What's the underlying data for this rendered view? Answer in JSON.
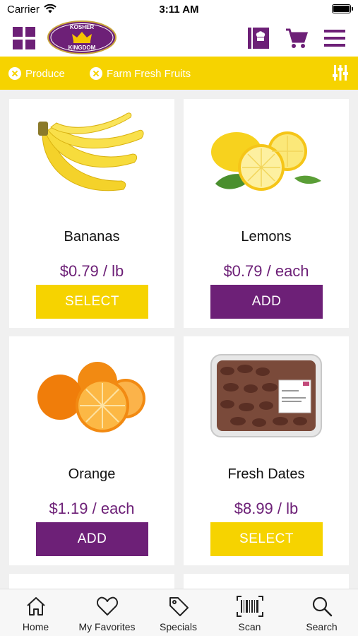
{
  "status_bar": {
    "carrier": "Carrier",
    "time": "3:11 AM"
  },
  "header": {
    "logo_text": {
      "top": "KOSHER",
      "bottom": "KINGDOM"
    },
    "icons": [
      "grid-icon",
      "recipe-book-icon",
      "cart-icon",
      "menu-icon"
    ]
  },
  "filters": [
    {
      "label": "Produce"
    },
    {
      "label": "Farm Fresh Fruits"
    }
  ],
  "products": [
    {
      "name": "Bananas",
      "price": "$0.79 / lb",
      "button": "SELECT",
      "button_style": "yellow"
    },
    {
      "name": "Lemons",
      "price": "$0.79 / each",
      "button": "ADD",
      "button_style": "purple"
    },
    {
      "name": "Orange",
      "price": "$1.19 / each",
      "button": "ADD",
      "button_style": "purple"
    },
    {
      "name": "Fresh Dates",
      "price": "$8.99 / lb",
      "button": "SELECT",
      "button_style": "yellow"
    }
  ],
  "tabbar": [
    {
      "label": "Home",
      "icon": "home-icon"
    },
    {
      "label": "My Favorites",
      "icon": "heart-icon"
    },
    {
      "label": "Specials",
      "icon": "tag-icon"
    },
    {
      "label": "Scan",
      "icon": "barcode-icon"
    },
    {
      "label": "Search",
      "icon": "search-icon"
    }
  ],
  "colors": {
    "brand_purple": "#6d2077",
    "brand_yellow": "#f6d300"
  }
}
